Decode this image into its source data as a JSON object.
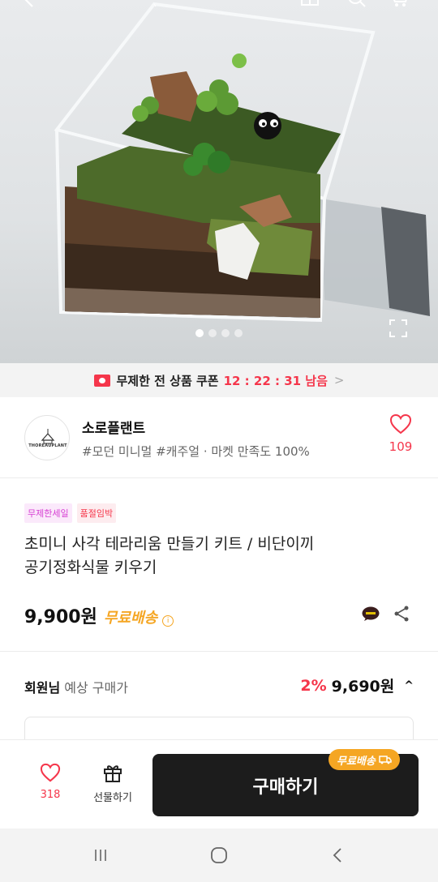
{
  "header": {
    "icons": [
      "back-icon",
      "home-icon",
      "search-icon",
      "cart-icon"
    ]
  },
  "gallery": {
    "total_images": 4,
    "current_index": 1
  },
  "coupon": {
    "label": "무제한 전 상품 쿠폰",
    "timer": "12 : 22 : 31 남음",
    "chevron": ">"
  },
  "store": {
    "logo_text": "THOREAUPLANT",
    "name": "소로플랜트",
    "tags": "#모던 미니멀 #캐주얼 · 마켓 만족도 100%",
    "like_count": "109"
  },
  "product": {
    "badges": [
      "무제한세일",
      "품절임박"
    ],
    "title_line1": "초미니 사각 테라리움 만들기 키트 / 비단이끼",
    "title_line2": "공기정화식물 키우기",
    "price": "9,900원",
    "shipping": "무료배송",
    "info_mark": "i"
  },
  "member": {
    "label_strong": "회원님",
    "label_rest": " 예상 구매가",
    "discount": "2%",
    "price": "9,690원",
    "caret": "^"
  },
  "actions": {
    "like_count": "318",
    "gift_label": "선물하기",
    "buy_label": "구매하기",
    "ship_tag": "무료배송"
  },
  "colors": {
    "accent": "#f5364b",
    "shipping": "#f5a623",
    "sale_badge": "#d63dd3",
    "buy_button": "#1c1c1c"
  }
}
